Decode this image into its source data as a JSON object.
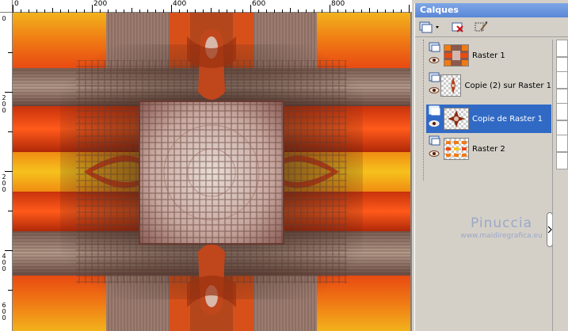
{
  "ruler": {
    "top_labels": [
      "0",
      "200",
      "400",
      "600",
      "800"
    ],
    "left_labels": [
      "0",
      "2",
      "0",
      "0",
      "2",
      "0",
      "0",
      "4",
      "0",
      "0",
      "6",
      "0",
      "0"
    ]
  },
  "palette": {
    "title": "Calques",
    "layers": [
      {
        "name": "Raster 1",
        "selected": false
      },
      {
        "name": "Copie (2) sur Raster 1",
        "selected": false
      },
      {
        "name": "Copie de Raster 1",
        "selected": true
      },
      {
        "name": "Raster 2",
        "selected": false
      }
    ]
  },
  "watermark": {
    "title": "Pinuccia",
    "url": "www.maidiregrafica.eu"
  },
  "colors": {
    "selection": "#316ac5",
    "title_bar": "#5a86d6",
    "orange": "#e8501a",
    "yellow": "#f2b21c"
  },
  "icons": {
    "new_layer": "new-layer-icon",
    "delete_layer": "delete-layer-icon",
    "properties": "layer-properties-icon"
  }
}
